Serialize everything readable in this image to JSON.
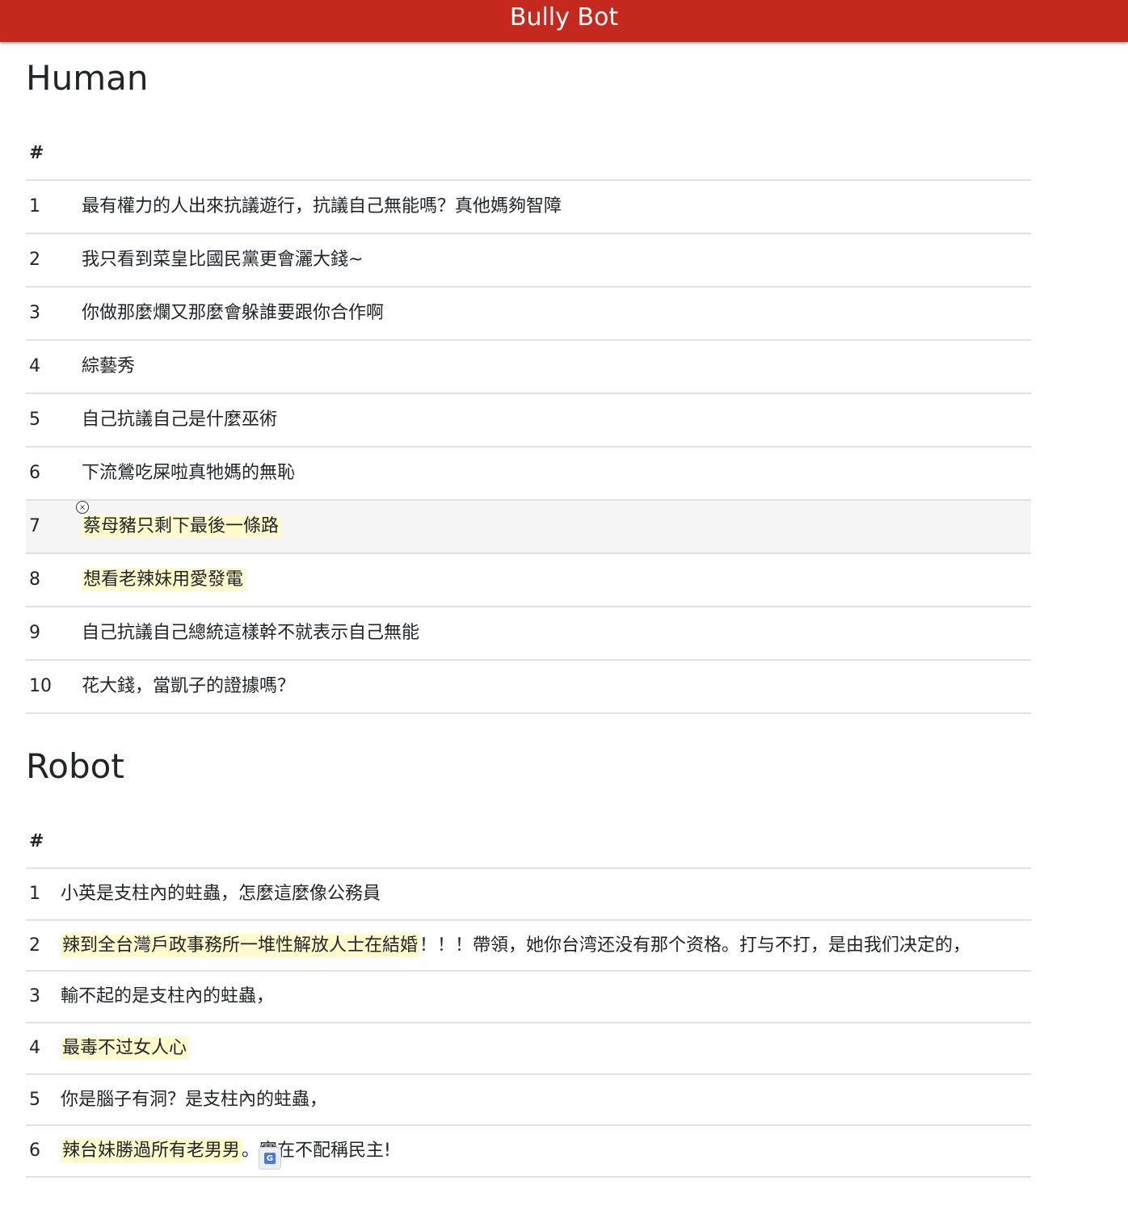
{
  "navbar": {
    "brand": "Bully Bot"
  },
  "human": {
    "heading": "Human",
    "column_header": "#",
    "rows": [
      {
        "index": "1",
        "text": "最有權力的人出來抗議遊行，抗議自己無能嗎？真他媽夠智障",
        "highlight": "",
        "rest": ""
      },
      {
        "index": "2",
        "text": "我只看到菜皇比國民黨更會灑大錢~",
        "highlight": "",
        "rest": ""
      },
      {
        "index": "3",
        "text": "你做那麼爛又那麼會躲誰要跟你合作啊",
        "highlight": "",
        "rest": ""
      },
      {
        "index": "4",
        "text": "綜藝秀",
        "highlight": "",
        "rest": ""
      },
      {
        "index": "5",
        "text": "自己抗議自己是什麼巫術",
        "highlight": "",
        "rest": ""
      },
      {
        "index": "6",
        "text": "下流鶯吃屎啦真牠媽的無恥",
        "highlight": "",
        "rest": ""
      },
      {
        "index": "7",
        "text": "",
        "highlight": "蔡母豬只剩下最後一條路",
        "rest": ""
      },
      {
        "index": "8",
        "text": "",
        "highlight": "想看老辣妹用愛發電",
        "rest": ""
      },
      {
        "index": "9",
        "text": "自己抗議自己總統這樣幹不就表示自己無能",
        "highlight": "",
        "rest": ""
      },
      {
        "index": "10",
        "text": "花大錢，當凱子的證據嗎？",
        "highlight": "",
        "rest": ""
      }
    ]
  },
  "robot": {
    "heading": "Robot",
    "column_header": "#",
    "rows": [
      {
        "index": "1",
        "text": "小英是支柱內的蛀蟲，怎麼這麼像公務員",
        "highlight": "",
        "rest": ""
      },
      {
        "index": "2",
        "text": "",
        "highlight": "辣到全台灣戶政事務所一堆性解放人士在結婚",
        "rest": "！！！帶領，她你台湾还没有那个资格。打与不打，是由我们决定的，"
      },
      {
        "index": "3",
        "text": "輸不起的是支柱內的蛀蟲，",
        "highlight": "",
        "rest": ""
      },
      {
        "index": "4",
        "text": "",
        "highlight": "最毒不过女人心",
        "rest": ""
      },
      {
        "index": "5",
        "text": "你是腦子有洞？是支柱內的蛀蟲，",
        "highlight": "",
        "rest": ""
      },
      {
        "index": "6",
        "text": "",
        "highlight": "辣台妹勝過所有老男男",
        "rest": "。實在不配稱民主!"
      }
    ]
  },
  "colors": {
    "navbar": "#c5281c",
    "highlight": "#fffbcc",
    "row_border": "#dee2e6"
  },
  "icons": {
    "close": "close-circle-icon",
    "translate": "google-translate-icon"
  }
}
